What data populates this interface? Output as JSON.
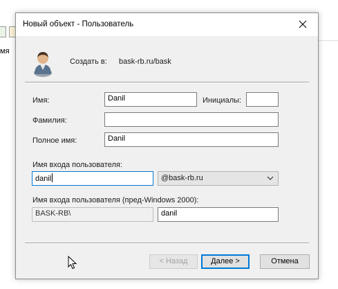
{
  "background": {
    "side_text": "мя"
  },
  "dialog": {
    "title": "Новый объект - Пользователь",
    "create_in_label": "Создать в:",
    "create_in_value": "bask-rb.ru/bask",
    "first_name": {
      "label": "Имя:",
      "value": "Danil"
    },
    "initials": {
      "label": "Инициалы:",
      "value": ""
    },
    "last_name": {
      "label": "Фамилия:",
      "value": ""
    },
    "full_name": {
      "label": "Полное имя:",
      "value": "Danil"
    },
    "logon_name": {
      "label": "Имя входа пользователя:",
      "value": "danil"
    },
    "upn_suffix": {
      "selected": "@bask-rb.ru"
    },
    "legacy_logon": {
      "label": "Имя входа пользователя (пред-Windows 2000):",
      "domain": "BASK-RB\\",
      "value": "danil"
    },
    "buttons": {
      "back": "< Назад",
      "next": "Далее >",
      "cancel": "Отмена"
    }
  },
  "colors": {
    "focus_border": "#0078d7",
    "dialog_bg": "#f0f0f0"
  },
  "icons": [
    "user-icon",
    "close-icon",
    "chevron-down-icon",
    "mouse-pointer-icon"
  ]
}
